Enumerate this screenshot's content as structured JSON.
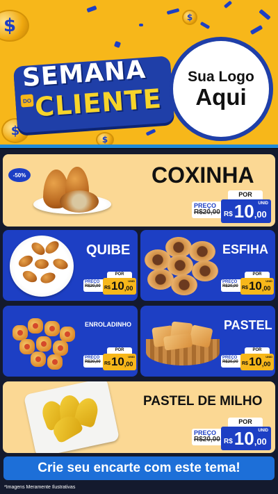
{
  "header": {
    "title_line1": "SEMANA",
    "title_do": "DO",
    "title_line2": "CLIENTE",
    "logo_line1": "Sua Logo",
    "logo_line2": "Aqui",
    "coin_symbol": "$"
  },
  "products": [
    {
      "name": "COXINHA",
      "badge": "-50%",
      "por": "POR",
      "preco_label": "PREÇO",
      "old_price": "R$20,00",
      "currency": "R$",
      "price_int": "10",
      "price_dec": ",00",
      "unit": "UNID"
    },
    {
      "name": "QUIBE",
      "por": "POR",
      "preco_label": "PREÇO",
      "old_price": "R$20,00",
      "currency": "R$",
      "price_int": "10",
      "price_dec": ",00",
      "unit": "UNID"
    },
    {
      "name": "ESFIHA",
      "por": "POR",
      "preco_label": "PREÇO",
      "old_price": "R$20,00",
      "currency": "R$",
      "price_int": "10",
      "price_dec": ",00",
      "unit": "UNID"
    },
    {
      "name": "ENROLADINHO",
      "por": "POR",
      "preco_label": "PREÇO",
      "old_price": "R$20,00",
      "currency": "R$",
      "price_int": "10",
      "price_dec": ",00",
      "unit": "UNID"
    },
    {
      "name": "PASTEL",
      "por": "POR",
      "preco_label": "PREÇO",
      "old_price": "R$20,00",
      "currency": "R$",
      "price_int": "10",
      "price_dec": ",00",
      "unit": "UNID"
    },
    {
      "name": "PASTEL DE MILHO",
      "por": "POR",
      "preco_label": "PREÇO",
      "old_price": "R$20,00",
      "currency": "R$",
      "price_int": "10",
      "price_dec": ",00",
      "unit": "UNID"
    }
  ],
  "cta": "Crie seu encarte com este tema!",
  "disclaimer": "*Imagens Meramente Ilustrativas",
  "colors": {
    "yellow": "#f7b71a",
    "blue": "#1d3fc4",
    "cream": "#fbd894",
    "cta_blue": "#1d6fd8"
  }
}
